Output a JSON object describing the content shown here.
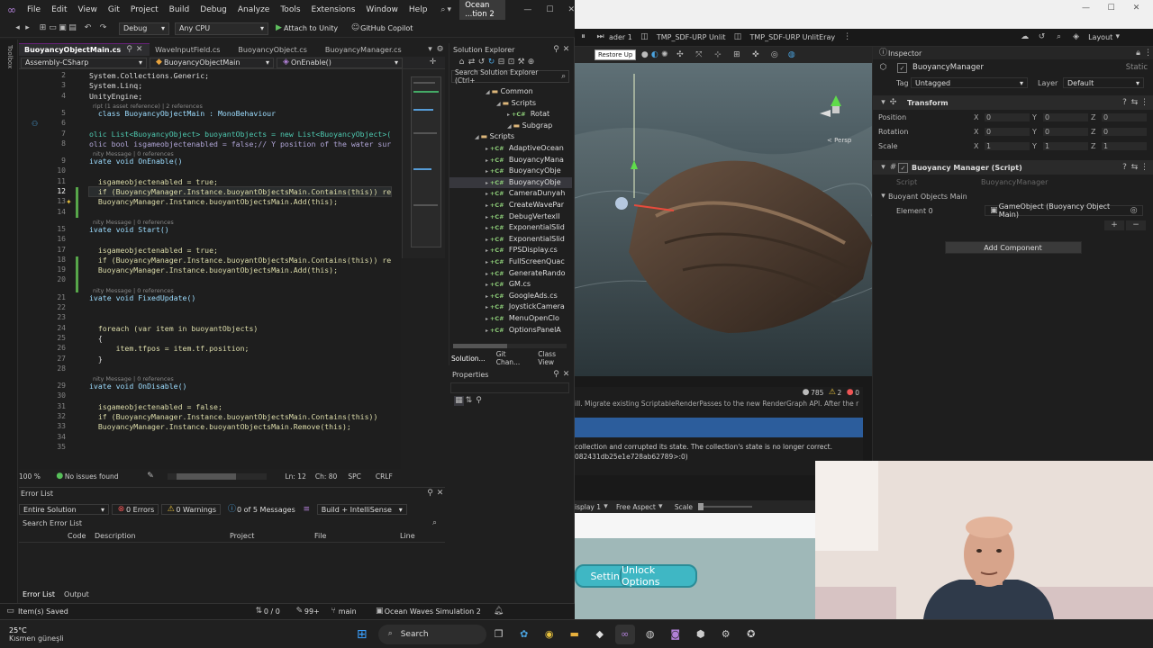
{
  "vs": {
    "menu": [
      "File",
      "Edit",
      "View",
      "Git",
      "Project",
      "Build",
      "Debug",
      "Analyze",
      "Tools",
      "Extensions",
      "Window",
      "Help"
    ],
    "solution_title": "Ocean ...tion 2",
    "toolbar": {
      "config": "Debug",
      "platform": "Any CPU",
      "attach": "Attach to Unity",
      "copilot": "GitHub Copilot"
    },
    "left_strip_label": "Toolbox",
    "tabs": [
      "BuoyancyObjectMain.cs",
      "WaveInputField.cs",
      "BuoyancyObject.cs",
      "BuoyancyManager.cs"
    ],
    "nav": {
      "project": "Assembly-CSharp",
      "class": "BuoyancyObjectMain",
      "member": "OnEnable()"
    },
    "code_lines": [
      {
        "n": "2",
        "t": "System.Collections.Generic;",
        "c": "plain"
      },
      {
        "n": "3",
        "t": "System.Linq;",
        "c": "plain"
      },
      {
        "n": "4",
        "t": "UnityEngine;",
        "c": "plain"
      },
      {
        "n": "",
        "t": "ript (1 asset reference) | 2 references",
        "c": "lens"
      },
      {
        "n": "5",
        "t": "  class BuoyancyObjectMain : MonoBehaviour",
        "c": "class"
      },
      {
        "n": "6",
        "t": "",
        "c": "plain"
      },
      {
        "n": "7",
        "t": "olic List<BuoyancyObject> buoyantObjects = new List<BuoyancyObject>(",
        "c": "decl"
      },
      {
        "n": "8",
        "t": "olic bool isgameobjectenabled = false;// Y position of the water sur",
        "c": "decl2"
      },
      {
        "n": "",
        "t": "nity Message | 0 references",
        "c": "lens"
      },
      {
        "n": "9",
        "t": "ivate void OnEnable()",
        "c": "method"
      },
      {
        "n": "10",
        "t": "",
        "c": "plain"
      },
      {
        "n": "11",
        "t": "  isgameobjectenabled = true;",
        "c": "body"
      },
      {
        "n": "12",
        "t": "  if (BuoyancyManager.Instance.buoyantObjectsMain.Contains(this)) re",
        "c": "body"
      },
      {
        "n": "13",
        "t": "  BuoyancyManager.Instance.buoyantObjectsMain.Add(this);",
        "c": "body"
      },
      {
        "n": "14",
        "t": "",
        "c": "plain"
      },
      {
        "n": "",
        "t": "nity Message | 0 references",
        "c": "lens"
      },
      {
        "n": "15",
        "t": "ivate void Start()",
        "c": "method"
      },
      {
        "n": "16",
        "t": "",
        "c": "plain"
      },
      {
        "n": "17",
        "t": "  isgameobjectenabled = true;",
        "c": "body"
      },
      {
        "n": "18",
        "t": "  if (BuoyancyManager.Instance.buoyantObjectsMain.Contains(this)) re",
        "c": "body"
      },
      {
        "n": "19",
        "t": "  BuoyancyManager.Instance.buoyantObjectsMain.Add(this);",
        "c": "body"
      },
      {
        "n": "20",
        "t": "",
        "c": "plain"
      },
      {
        "n": "",
        "t": "nity Message | 0 references",
        "c": "lens"
      },
      {
        "n": "21",
        "t": "ivate void FixedUpdate()",
        "c": "method"
      },
      {
        "n": "22",
        "t": "",
        "c": "plain"
      },
      {
        "n": "23",
        "t": "",
        "c": "plain"
      },
      {
        "n": "24",
        "t": "  foreach (var item in buoyantObjects)",
        "c": "body"
      },
      {
        "n": "25",
        "t": "  {",
        "c": "plain"
      },
      {
        "n": "26",
        "t": "      item.tfpos = item.tf.position;",
        "c": "body"
      },
      {
        "n": "27",
        "t": "  }",
        "c": "plain"
      },
      {
        "n": "28",
        "t": "",
        "c": "plain"
      },
      {
        "n": "",
        "t": "nity Message | 0 references",
        "c": "lens"
      },
      {
        "n": "29",
        "t": "ivate void OnDisable()",
        "c": "method"
      },
      {
        "n": "30",
        "t": "",
        "c": "plain"
      },
      {
        "n": "31",
        "t": "  isgameobjectenabled = false;",
        "c": "body"
      },
      {
        "n": "32",
        "t": "  if (BuoyancyManager.Instance.buoyantObjectsMain.Contains(this))",
        "c": "body"
      },
      {
        "n": "33",
        "t": "  BuoyancyManager.Instance.buoyantObjectsMain.Remove(this);",
        "c": "body"
      },
      {
        "n": "34",
        "t": "",
        "c": "plain"
      },
      {
        "n": "35",
        "t": "",
        "c": "plain"
      }
    ],
    "editor_status": {
      "zoom": "100 %",
      "issues": "No issues found",
      "line": "Ln: 12",
      "col": "Ch: 80",
      "spc": "SPC",
      "crlf": "CRLF"
    },
    "error_list": {
      "title": "Error List",
      "scope": "Entire Solution",
      "errors": "0 Errors",
      "warnings": "0 Warnings",
      "messages": "0 of 5 Messages",
      "build": "Build + IntelliSense",
      "search": "Search Error List",
      "columns": [
        "Code",
        "Description",
        "Project",
        "File",
        "Line"
      ]
    },
    "solution_explorer": {
      "title": "Solution Explorer",
      "search": "Search Solution Explorer (Ctrl+",
      "items": [
        {
          "label": "Common",
          "level": 3,
          "kind": "folder"
        },
        {
          "label": "Scripts",
          "level": 4,
          "kind": "folder"
        },
        {
          "label": "Rotat",
          "level": 5,
          "kind": "cs"
        },
        {
          "label": "Subgrap",
          "level": 5,
          "kind": "folder"
        },
        {
          "label": "Scripts",
          "level": 2,
          "kind": "folder"
        },
        {
          "label": "AdaptiveOcean",
          "level": 3,
          "kind": "cs"
        },
        {
          "label": "BuoyancyMana",
          "level": 3,
          "kind": "cs"
        },
        {
          "label": "BuoyancyObje",
          "level": 3,
          "kind": "cs"
        },
        {
          "label": "BuoyancyObje",
          "level": 3,
          "kind": "cs",
          "selected": true
        },
        {
          "label": "CameraDunyah",
          "level": 3,
          "kind": "cs"
        },
        {
          "label": "CreateWavePar",
          "level": 3,
          "kind": "cs"
        },
        {
          "label": "DebugVertexIl",
          "level": 3,
          "kind": "cs"
        },
        {
          "label": "ExponentialSlid",
          "level": 3,
          "kind": "cs"
        },
        {
          "label": "ExponentialSlid",
          "level": 3,
          "kind": "cs"
        },
        {
          "label": "FPSDisplay.cs",
          "level": 3,
          "kind": "cs"
        },
        {
          "label": "FullScreenQuac",
          "level": 3,
          "kind": "cs"
        },
        {
          "label": "GenerateRando",
          "level": 3,
          "kind": "cs"
        },
        {
          "label": "GM.cs",
          "level": 3,
          "kind": "cs"
        },
        {
          "label": "GoogleAds.cs",
          "level": 3,
          "kind": "cs"
        },
        {
          "label": "JoystickCamera",
          "level": 3,
          "kind": "cs"
        },
        {
          "label": "MenuOpenClo",
          "level": 3,
          "kind": "cs"
        },
        {
          "label": "OptionsPanelA",
          "level": 3,
          "kind": "cs"
        }
      ],
      "bottom_tabs": [
        "Solution...",
        "Git Chan...",
        "Class View"
      ]
    },
    "properties_title": "Properties",
    "bottom_tabs": [
      "Error List",
      "Output"
    ],
    "statusbar": {
      "saved": "Item(s) Saved",
      "git_updown": "0 / 0",
      "edits": "99+",
      "branch": "main",
      "repo": "Ocean Waves Simulation 2"
    }
  },
  "unity": {
    "tabs": [
      "ader 1",
      "TMP_SDF-URP Unlit",
      "TMP_SDF-URP UnlitEray"
    ],
    "layout_label": "Layout",
    "restore_tooltip": "Restore Up",
    "persp_label": "< Persp",
    "console": {
      "count_logs": "785",
      "count_warn": "2",
      "count_err": "0",
      "line1": "ill. Migrate existing ScriptableRenderPasses to the new RenderGraph API. After the r",
      "line2": "collection and corrupted its state. The collection's state is no longer correct.",
      "line3": "082431db25e1e728ab62789>:0)"
    },
    "game": {
      "display": "isplay 1",
      "aspect": "Free Aspect",
      "scale": "Scale",
      "btn_settings": "Settings",
      "btn_unlock": "Unlock Options"
    },
    "inspector": {
      "title": "Inspector",
      "object_name": "BuoyancyManager",
      "static_label": "Static",
      "tag_label": "Tag",
      "tag_value": "Untagged",
      "layer_label": "Layer",
      "layer_value": "Default",
      "transform": {
        "title": "Transform",
        "rows": [
          {
            "label": "Position",
            "x": "0",
            "y": "0",
            "z": "0"
          },
          {
            "label": "Rotation",
            "x": "0",
            "y": "0",
            "z": "0"
          },
          {
            "label": "Scale",
            "x": "1",
            "y": "1",
            "z": "1"
          }
        ]
      },
      "component_title": "Buoyancy Manager (Script)",
      "script_label": "Script",
      "script_value": "BuoyancyManager",
      "list_label": "Buoyant Objects Main",
      "element_label": "Element 0",
      "element_value": "GameObject (Buoyancy Object Main)",
      "add_component": "Add Component"
    }
  },
  "taskbar": {
    "temp": "25°C",
    "weather": "Kısmen güneşli",
    "search": "Search"
  },
  "colors": {
    "vs_bg": "#1f1f1f",
    "vs_accent": "#68217a",
    "keyword": "#569cd6",
    "type": "#4ec9b0",
    "game_button": "#3fb7c4"
  }
}
